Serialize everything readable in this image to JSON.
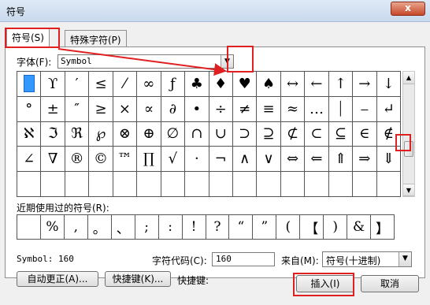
{
  "window": {
    "title": "符号",
    "close": "x"
  },
  "tabs": [
    {
      "label": "符号(S)"
    },
    {
      "label": "特殊字符(P)"
    }
  ],
  "font": {
    "label": "字体(F):",
    "value": "Symbol"
  },
  "symbols": [
    "",
    "ϒ",
    "′",
    "≤",
    "⁄",
    "∞",
    "ƒ",
    "♣",
    "♦",
    "♥",
    "♠",
    "↔",
    "←",
    "↑",
    "→",
    "↓",
    "°",
    "±",
    "″",
    "≥",
    "×",
    "∝",
    "∂",
    "•",
    "÷",
    "≠",
    "≡",
    "≈",
    "…",
    "⏐",
    "⎯",
    "↵",
    "ℵ",
    "ℑ",
    "ℜ",
    "℘",
    "⊗",
    "⊕",
    "∅",
    "∩",
    "∪",
    "⊃",
    "⊇",
    "⊄",
    "⊂",
    "⊆",
    "∈",
    "∉",
    "∠",
    "∇",
    "®",
    "©",
    "™",
    "∏",
    "√",
    "⋅",
    "¬",
    "∧",
    "∨",
    "⇔",
    "⇐",
    "⇑",
    "⇒",
    "⇓",
    "",
    "",
    "",
    "",
    "",
    "",
    "",
    "",
    "",
    "",
    "",
    "",
    "",
    "",
    "",
    ""
  ],
  "recent": {
    "label": "近期使用过的符号(R):",
    "symbols": [
      "",
      "%",
      ",",
      "。",
      "、",
      ";",
      ":",
      "!",
      "?",
      "“",
      "”",
      "(",
      "【",
      ")",
      "&",
      "】"
    ]
  },
  "status": {
    "symbol_name": "Symbol: 160",
    "code_label": "字符代码(C):",
    "code_value": "160",
    "from_label": "来自(M):",
    "from_value": "符号(十进制)"
  },
  "buttons": {
    "autocorrect": "自动更正(A)...",
    "shortcut_key": "快捷键(K)...",
    "shortcut_label": "快捷键:",
    "insert": "插入(I)",
    "cancel": "取消"
  },
  "annotation_color": "#e02020"
}
